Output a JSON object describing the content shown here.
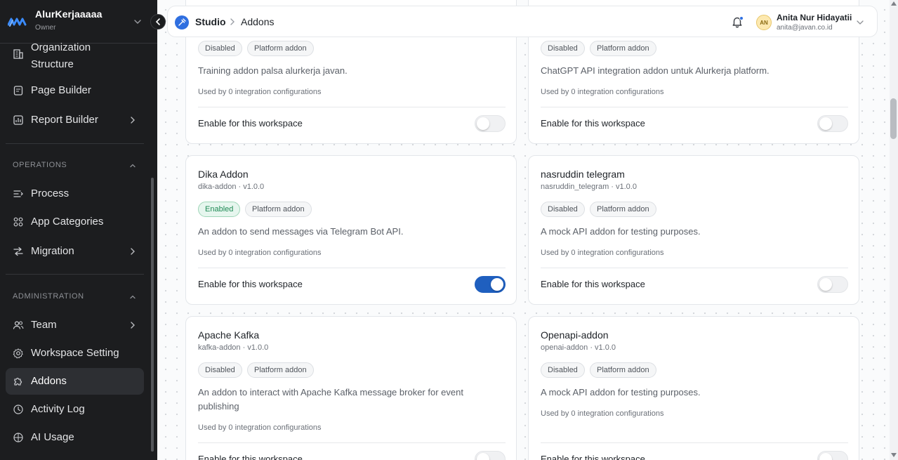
{
  "workspace": {
    "name": "AlurKerjaaaaa",
    "role": "Owner"
  },
  "sidebar": {
    "items_top": [
      {
        "label": "Organization\nStructure",
        "label_line1": "Organization",
        "label_line2": "Structure",
        "icon": "building-icon"
      },
      {
        "label": "Page Builder",
        "icon": "page-icon"
      },
      {
        "label": "Report Builder",
        "icon": "report-icon"
      }
    ],
    "operations": {
      "title": "OPERATIONS",
      "items": [
        {
          "label": "Process",
          "icon": "process-icon"
        },
        {
          "label": "App Categories",
          "icon": "grid-icon"
        },
        {
          "label": "Migration",
          "icon": "migration-icon"
        }
      ]
    },
    "administration": {
      "title": "ADMINISTRATION",
      "items": [
        {
          "label": "Team",
          "icon": "team-icon"
        },
        {
          "label": "Workspace Setting",
          "icon": "gear-icon"
        },
        {
          "label": "Addons",
          "icon": "puzzle-icon",
          "active": true
        },
        {
          "label": "Activity Log",
          "icon": "activity-icon"
        },
        {
          "label": "AI Usage",
          "icon": "ai-icon"
        }
      ]
    }
  },
  "header": {
    "breadcrumb": [
      "Studio",
      "Addons"
    ],
    "user": {
      "initials": "AN",
      "name": "Anita Nur Hidayatii",
      "email": "anita@javan.co.id"
    }
  },
  "cards": [
    {
      "title": "",
      "subtitle": "",
      "status": "Disabled",
      "type": "Platform addon",
      "description": "Training addon palsa alurkerja javan.",
      "used": "Used by 0 integration configurations",
      "enable_label": "Enable for this workspace",
      "enabled": false
    },
    {
      "title": "",
      "subtitle": "",
      "status": "Disabled",
      "type": "Platform addon",
      "description": "ChatGPT API integration addon untuk Alurkerja platform.",
      "used": "Used by 0 integration configurations",
      "enable_label": "Enable for this workspace",
      "enabled": false
    },
    {
      "title": "Dika Addon",
      "subtitle": "dika-addon · v1.0.0",
      "status": "Enabled",
      "type": "Platform addon",
      "description": "An addon to send messages via Telegram Bot API.",
      "used": "Used by 0 integration configurations",
      "enable_label": "Enable for this workspace",
      "enabled": true
    },
    {
      "title": "nasruddin telegram",
      "subtitle": "nasruddin_telegram · v1.0.0",
      "status": "Disabled",
      "type": "Platform addon",
      "description": "A mock API addon for testing purposes.",
      "used": "Used by 0 integration configurations",
      "enable_label": "Enable for this workspace",
      "enabled": false
    },
    {
      "title": "Apache Kafka",
      "subtitle": "kafka-addon · v1.0.0",
      "status": "Disabled",
      "type": "Platform addon",
      "description": "An addon to interact with Apache Kafka message broker for event publishing",
      "used": "Used by 0 integration configurations",
      "enable_label": "Enable for this workspace",
      "enabled": false
    },
    {
      "title": "Openapi-addon",
      "subtitle": "openai-addon · v1.0.0",
      "status": "Disabled",
      "type": "Platform addon",
      "description": "A mock API addon for testing purposes.",
      "used": "Used by 0 integration configurations",
      "enable_label": "Enable for this workspace",
      "enabled": false
    }
  ],
  "colors": {
    "accent": "#1f5fbf",
    "sidebar_bg": "#1c1d1f",
    "enabled_badge": "#1f8a55"
  }
}
